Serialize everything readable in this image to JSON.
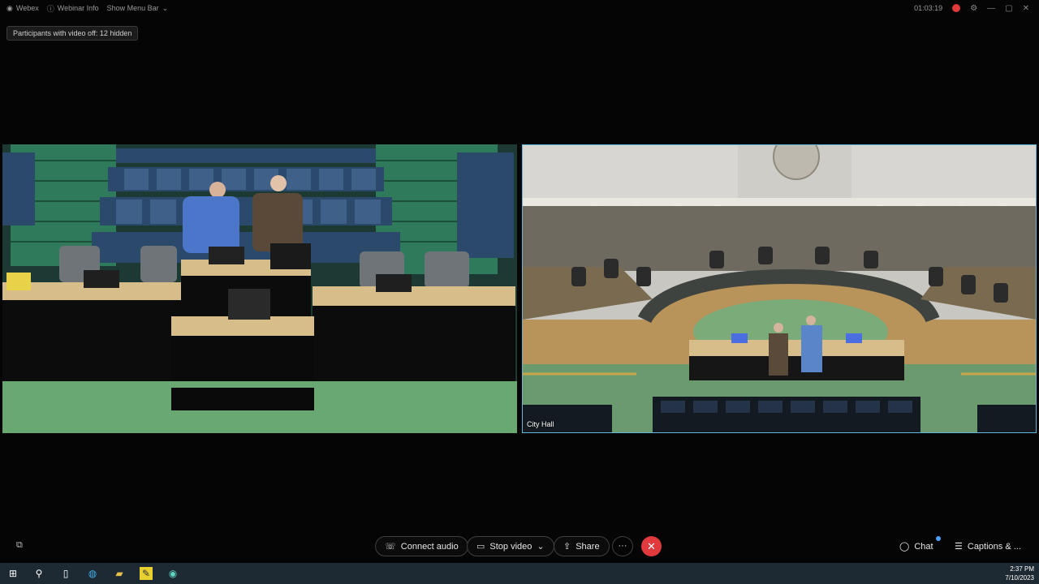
{
  "topbar": {
    "app_name": "Webex",
    "webinar_info": "Webinar Info",
    "show_menu_bar": "Show Menu Bar",
    "timer": "01:03:19"
  },
  "participants_notice": "Participants with video off: 12 hidden",
  "videos": {
    "right_label": "City Hall"
  },
  "controls": {
    "connect_audio": "Connect audio",
    "stop_video": "Stop video",
    "share": "Share",
    "more": "···",
    "end": "✕",
    "chat": "Chat",
    "captions": "Captions & ..."
  },
  "taskbar": {
    "time": "2:37 PM",
    "date": "7/10/2023"
  },
  "colors": {
    "accent": "#5fb7d9",
    "end_call": "#e0393e",
    "taskbar": "#1e2a33"
  }
}
